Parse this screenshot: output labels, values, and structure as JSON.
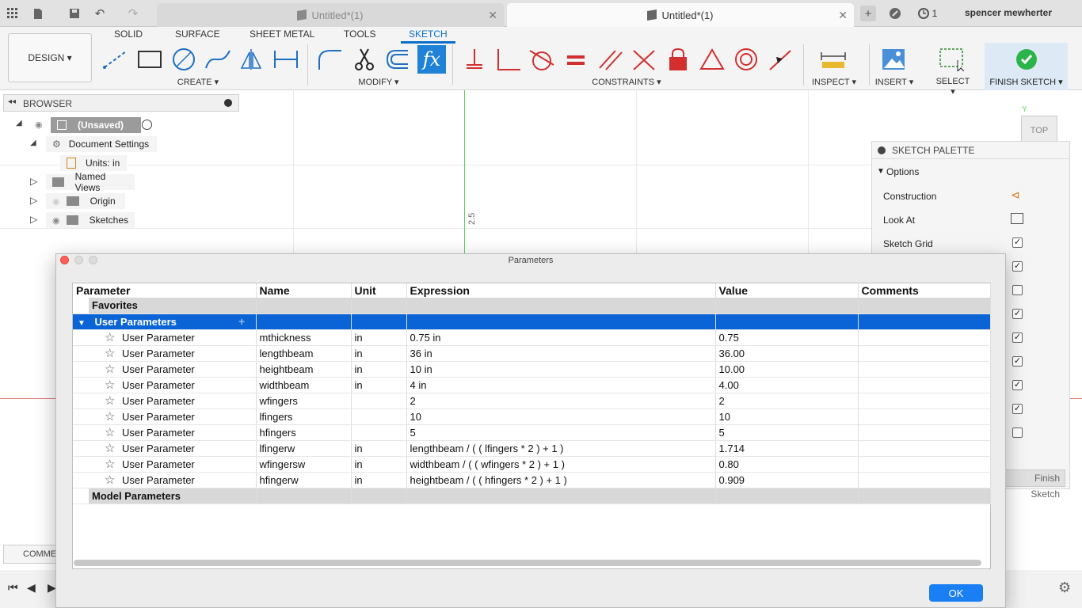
{
  "titlebar": {
    "tabs": [
      {
        "label": "Untitled*(1)",
        "active": false
      },
      {
        "label": "Untitled*(1)",
        "active": true
      }
    ],
    "job_count": "1",
    "user": "spencer mewherter"
  },
  "ribbon": {
    "design_label": "DESIGN ▾",
    "tabs": [
      "SOLID",
      "SURFACE",
      "SHEET METAL",
      "TOOLS",
      "SKETCH"
    ],
    "active_tab": "SKETCH",
    "groups": {
      "create": "CREATE ▾",
      "modify": "MODIFY ▾",
      "constraints": "CONSTRAINTS ▾",
      "inspect": "INSPECT ▾",
      "insert": "INSERT ▾",
      "select": "SELECT ▾",
      "finish": "FINISH SKETCH ▾"
    },
    "accent": "#0b6fc9"
  },
  "browser": {
    "title": "BROWSER",
    "items": [
      {
        "label": "(Unsaved)"
      },
      {
        "label": "Document Settings"
      },
      {
        "label": "Units: in"
      },
      {
        "label": "Named Views"
      },
      {
        "label": "Origin"
      },
      {
        "label": "Sketches"
      }
    ]
  },
  "viewport": {
    "dimension_label": "2.5",
    "viewcube_face": "TOP",
    "axis_label": "Y"
  },
  "sketch_palette": {
    "title": "SKETCH PALETTE",
    "section": "Options",
    "options": [
      {
        "label": "Construction"
      },
      {
        "label": "Look At"
      },
      {
        "label": "Sketch Grid",
        "checked": true
      }
    ],
    "extra_checks": [
      true,
      false,
      true,
      true,
      true,
      true,
      true,
      false
    ],
    "finish_button": "Finish Sketch"
  },
  "parameters_dialog": {
    "title": "Parameters",
    "columns": [
      "Parameter",
      "Name",
      "Unit",
      "Expression",
      "Value",
      "Comments"
    ],
    "categories": {
      "favorites": "Favorites",
      "user": "User Parameters",
      "model": "Model Parameters"
    },
    "rows": [
      {
        "type": "User Parameter",
        "name": "mthickness",
        "unit": "in",
        "expression": "0.75 in",
        "value": "0.75",
        "comments": ""
      },
      {
        "type": "User Parameter",
        "name": "lengthbeam",
        "unit": "in",
        "expression": "36 in",
        "value": "36.00",
        "comments": ""
      },
      {
        "type": "User Parameter",
        "name": "heightbeam",
        "unit": "in",
        "expression": "10 in",
        "value": "10.00",
        "comments": ""
      },
      {
        "type": "User Parameter",
        "name": "widthbeam",
        "unit": "in",
        "expression": "4 in",
        "value": "4.00",
        "comments": ""
      },
      {
        "type": "User Parameter",
        "name": "wfingers",
        "unit": "",
        "expression": "2",
        "value": "2",
        "comments": ""
      },
      {
        "type": "User Parameter",
        "name": "lfingers",
        "unit": "",
        "expression": "10",
        "value": "10",
        "comments": ""
      },
      {
        "type": "User Parameter",
        "name": "hfingers",
        "unit": "",
        "expression": "5",
        "value": "5",
        "comments": ""
      },
      {
        "type": "User Parameter",
        "name": "lfingerw",
        "unit": "in",
        "expression": "lengthbeam / ( ( lfingers * 2 ) + 1 )",
        "value": "1.714",
        "comments": ""
      },
      {
        "type": "User Parameter",
        "name": "wfingersw",
        "unit": "in",
        "expression": "widthbeam / ( ( wfingers * 2 ) + 1 )",
        "value": "0.80",
        "comments": ""
      },
      {
        "type": "User Parameter",
        "name": "hfingerw",
        "unit": "in",
        "expression": "heightbeam / ( ( hfingers * 2 ) + 1 )",
        "value": "0.909",
        "comments": ""
      }
    ],
    "ok_label": "OK",
    "selection_color": "#0a64d6"
  },
  "bottom": {
    "comments_label": "COMME"
  }
}
